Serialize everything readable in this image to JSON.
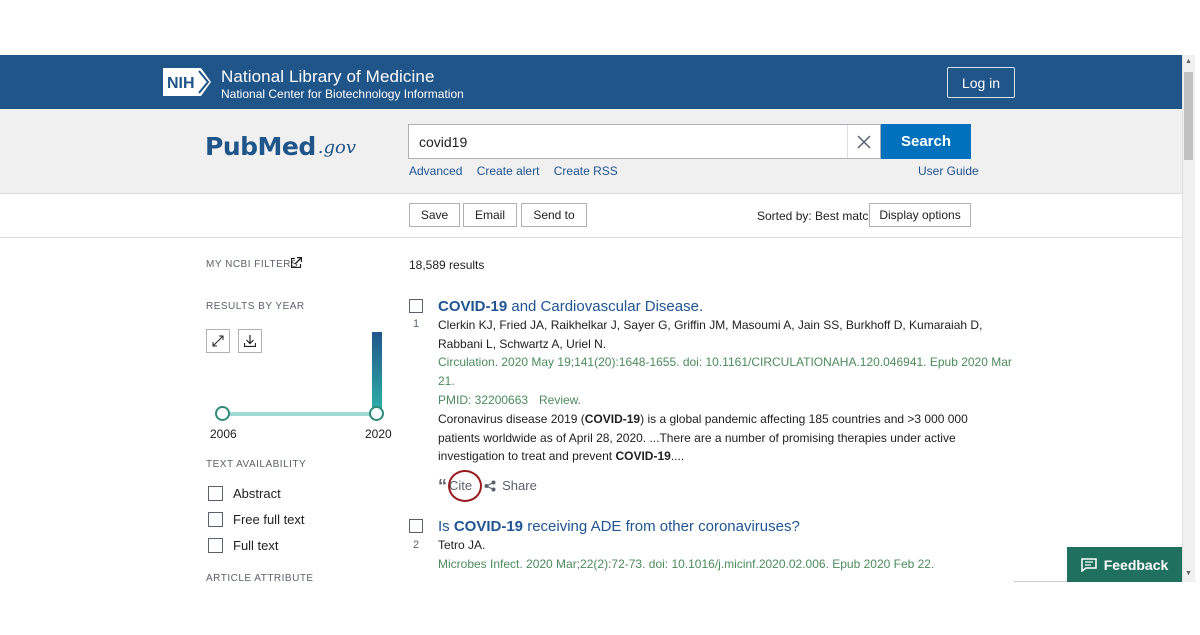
{
  "header": {
    "org_title": "National Library of Medicine",
    "org_subtitle": "National Center for Biotechnology Information",
    "login_label": "Log in"
  },
  "search": {
    "logo_main": "PubMed",
    "logo_suffix": ".gov",
    "query": "covid19",
    "button_label": "Search",
    "links": [
      "Advanced",
      "Create alert",
      "Create RSS"
    ],
    "user_guide": "User Guide"
  },
  "toolbar": {
    "save": "Save",
    "email": "Email",
    "send_to": "Send to",
    "sorted_by": "Sorted by: Best match",
    "display_options": "Display options"
  },
  "sidebar": {
    "my_filters": "MY NCBI FILTERS",
    "results_by_year": "RESULTS BY YEAR",
    "year_start": "2006",
    "year_end": "2020",
    "text_availability": "TEXT AVAILABILITY",
    "filters": [
      "Abstract",
      "Free full text",
      "Full text"
    ],
    "article_attribute": "ARTICLE ATTRIBUTE"
  },
  "results": {
    "count": "18,589 results",
    "items": [
      {
        "num": "1",
        "title_bold": "COVID-19",
        "title_rest": " and Cardiovascular Disease.",
        "authors_1": "Clerkin KJ, Fried JA, Raikhelkar J, Sayer G, Griffin JM, Masoumi A, Jain SS, Burkhoff D, Kumaraiah D,",
        "authors_2": "Rabbani L, Schwartz A, Uriel N.",
        "journal_1": "Circulation. 2020 May 19;141(20):1648-1655. doi: 10.1161/CIRCULATIONAHA.120.046941. Epub 2020 Mar",
        "journal_2": "21.",
        "pmid": "PMID: 32200663",
        "type": "Review.",
        "snippet_1a": "Coronavirus disease 2019 (",
        "snippet_1b": "COVID-19",
        "snippet_1c": ") is a global pandemic affecting 185 countries and >3 000 000",
        "snippet_2": "patients worldwide as of April 28, 2020. ...There are a number of promising therapies under active",
        "snippet_3a": "investigation to treat and prevent ",
        "snippet_3b": "COVID-19",
        "snippet_3c": "....",
        "cite": "Cite",
        "share": "Share"
      },
      {
        "num": "2",
        "title_pre": "Is ",
        "title_bold": "COVID-19",
        "title_rest": " receiving ADE from other coronaviruses?",
        "authors_1": "Tetro JA.",
        "journal_1": "Microbes Infect. 2020 Mar;22(2):72-73. doi: 10.1016/j.micinf.2020.02.006. Epub 2020 Feb 22."
      }
    ]
  },
  "feedback_label": "Feedback"
}
